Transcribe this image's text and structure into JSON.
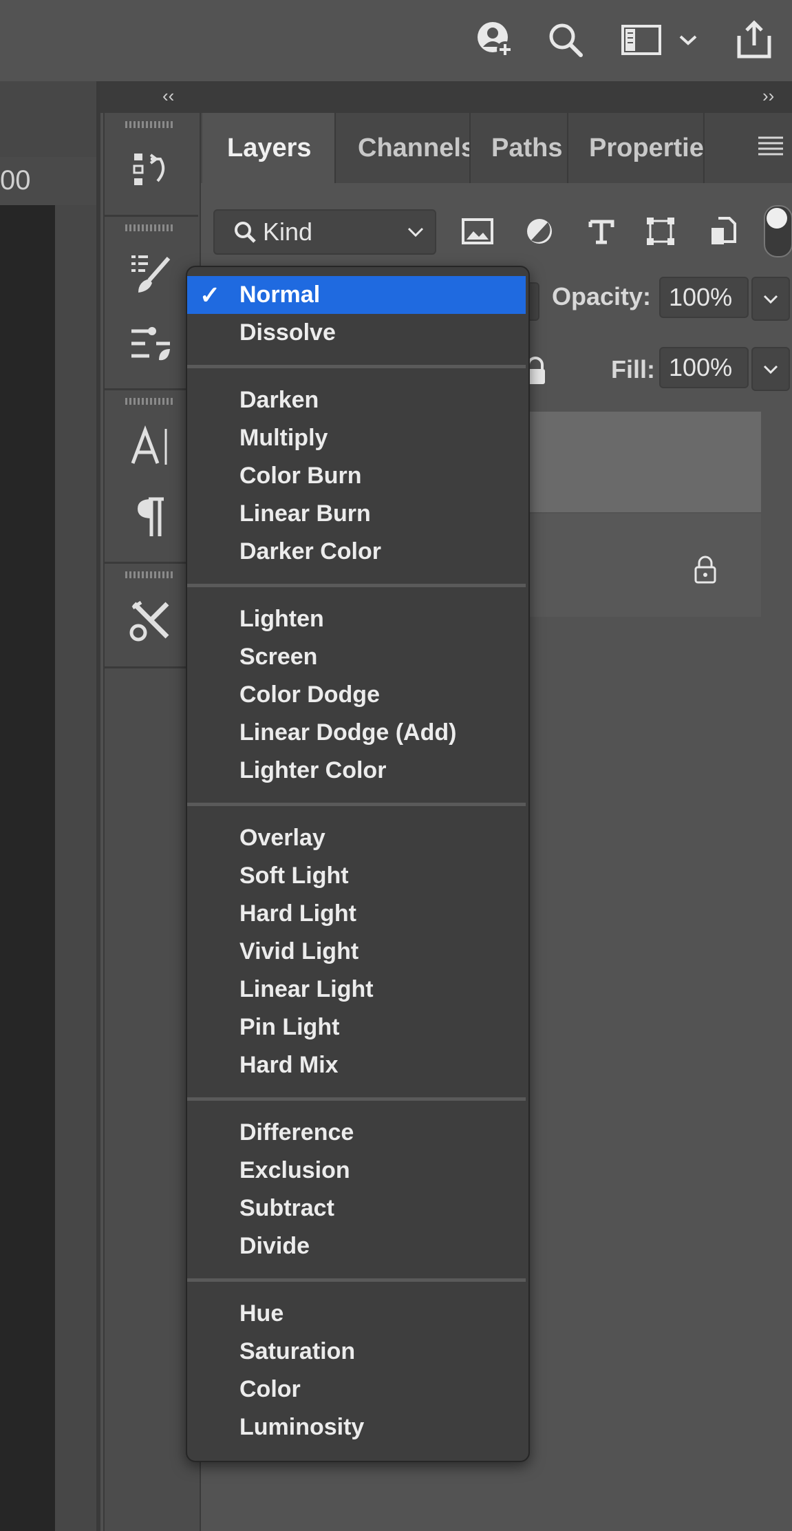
{
  "topbar": {
    "icons": [
      "add-user-icon",
      "search-icon",
      "workspace-icon",
      "chevron-down-icon",
      "share-icon"
    ]
  },
  "ruler": {
    "label": "00"
  },
  "panel": {
    "collapse_left": "‹‹",
    "collapse_right": "››",
    "tabs": [
      {
        "label": "Layers",
        "active": true
      },
      {
        "label": "Channels",
        "active": false
      },
      {
        "label": "Paths",
        "active": false
      },
      {
        "label": "Properties",
        "active": false
      }
    ],
    "filter": {
      "label": "Kind"
    },
    "opacity": {
      "label": "Opacity:",
      "value": "100%"
    },
    "fill": {
      "label": "Fill:",
      "value": "100%"
    }
  },
  "blend_menu": {
    "selected": "Normal",
    "check": "✓",
    "groups": [
      [
        "Normal",
        "Dissolve"
      ],
      [
        "Darken",
        "Multiply",
        "Color Burn",
        "Linear Burn",
        "Darker Color"
      ],
      [
        "Lighten",
        "Screen",
        "Color Dodge",
        "Linear Dodge (Add)",
        "Lighter Color"
      ],
      [
        "Overlay",
        "Soft Light",
        "Hard Light",
        "Vivid Light",
        "Linear Light",
        "Pin Light",
        "Hard Mix"
      ],
      [
        "Difference",
        "Exclusion",
        "Subtract",
        "Divide"
      ],
      [
        "Hue",
        "Saturation",
        "Color",
        "Luminosity"
      ]
    ]
  },
  "colors": {
    "accent": "#1f6ae0",
    "panel_bg": "#535353",
    "menu_bg": "#3e3e3e"
  }
}
